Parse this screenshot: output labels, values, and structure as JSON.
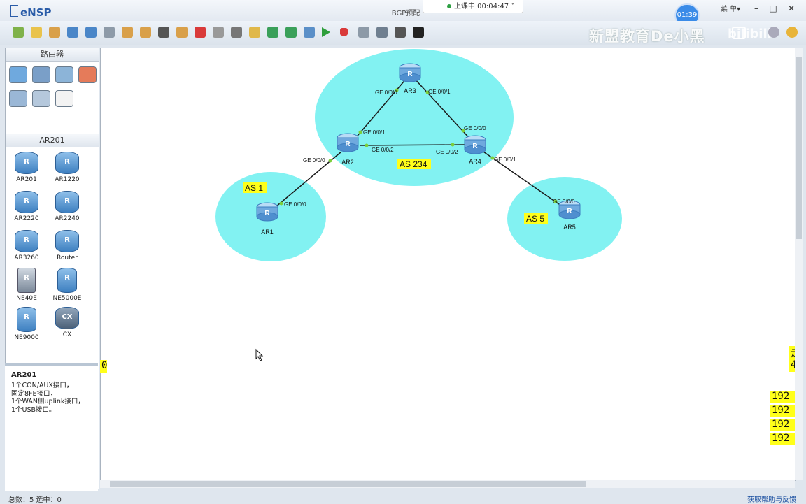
{
  "app": {
    "name": "eNSP",
    "window_title": "BGP预配",
    "live_status": "上课中 00:04:47",
    "timer_badge": "01:39",
    "menu_label": "菜 单▾"
  },
  "window_controls": {
    "minimize": "–",
    "maximize": "□",
    "close": "✕"
  },
  "toolbar": {
    "icons": [
      "new-topology-icon",
      "new-sample-icon",
      "open-icon",
      "save-icon",
      "save-as-icon",
      "print-icon",
      "undo-icon",
      "redo-icon",
      "select-icon",
      "pan-hand-icon",
      "delete-icon",
      "delete-link-icon",
      "text-annotation-icon",
      "rectangle-icon",
      "zoom-in-icon",
      "zoom-out-icon",
      "fit-icon",
      "start-device-icon",
      "stop-device-icon",
      "capture-icon",
      "topology-icon",
      "grid-icon",
      "console-icon"
    ],
    "colors": {
      "start": "#2e9e3b",
      "stop": "#d93a3a"
    }
  },
  "watermark": {
    "text": "新盟教育De小黑",
    "bili": "bilibili"
  },
  "left_panel": {
    "category_title": "路由器",
    "category_icons": [
      "router-category-icon",
      "switch-category-icon",
      "wireless-category-icon",
      "firewall-category-icon",
      "pc-category-icon",
      "cloud-category-icon",
      "other-device-icon"
    ],
    "series_title": "AR201",
    "devices": [
      {
        "label": "AR201",
        "shape": "router"
      },
      {
        "label": "AR1220",
        "shape": "router"
      },
      {
        "label": "AR2220",
        "shape": "router"
      },
      {
        "label": "AR2240",
        "shape": "router"
      },
      {
        "label": "AR3260",
        "shape": "router"
      },
      {
        "label": "Router",
        "shape": "router"
      },
      {
        "label": "NE40E",
        "shape": "tall"
      },
      {
        "label": "NE5000E",
        "shape": "cyl"
      },
      {
        "label": "NE9000",
        "shape": "cyl"
      },
      {
        "label": "CX",
        "shape": "dark"
      }
    ],
    "description": {
      "title": "AR201",
      "text": "1个CON/AUX接口，\n固定8FE接口，\n1个WAN侧uplink接口，\n1个USB接口。"
    }
  },
  "topology": {
    "as_labels": {
      "as1": "AS  1",
      "as234": "AS  234",
      "as5": "AS  5"
    },
    "routers": {
      "ar1": "AR1",
      "ar2": "AR2",
      "ar3": "AR3",
      "ar4": "AR4",
      "ar5": "AR5"
    },
    "ports": {
      "ar3_g000": "GE 0/0/0",
      "ar3_g001": "GE 0/0/1",
      "ar2_g001": "GE 0/0/1",
      "ar2_g002": "GE 0/0/2",
      "ar2_g000": "GE 0/0/0",
      "ar4_g000": "GE 0/0/0",
      "ar4_g002": "GE 0/0/2",
      "ar4_g001": "GE 0/0/1",
      "ar1_g000": "GE 0/0/0",
      "ar5_g000": "GE 0/0/0"
    },
    "colors": {
      "area": "#82f2f2",
      "link": "#1a1a1a",
      "port_dot": "#7ccf3a",
      "highlight": "#ffff1a"
    }
  },
  "edge_labels": {
    "left": "0",
    "right_top": [
      "走",
      "4"
    ],
    "right_list": [
      "192",
      "192",
      "192",
      "192"
    ]
  },
  "status": {
    "left": "总数：5  选中：0",
    "right": "获取帮助与反馈"
  }
}
